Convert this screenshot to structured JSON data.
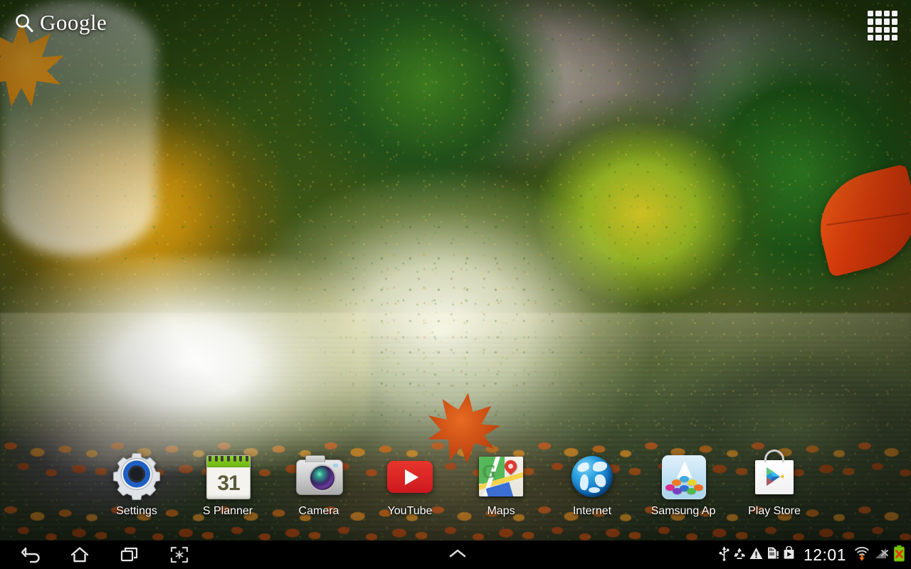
{
  "device": {
    "platform": "Android tablet home screen"
  },
  "search_widget": {
    "icon": "search-icon",
    "brand": "Google",
    "placeholder": "Search"
  },
  "apps_grid_button": {
    "icon": "apps-grid-icon",
    "label": "Apps",
    "cells": 16
  },
  "home_apps": [
    {
      "label": "Settings",
      "icon": "settings-gear-icon"
    },
    {
      "label": "S Planner",
      "icon": "calendar-icon",
      "day": "31"
    },
    {
      "label": "Camera",
      "icon": "camera-icon"
    },
    {
      "label": "YouTube",
      "icon": "youtube-icon"
    },
    {
      "label": "Maps",
      "icon": "maps-icon",
      "glyph": "G"
    },
    {
      "label": "Internet",
      "icon": "globe-icon"
    },
    {
      "label": "Samsung Ap",
      "icon": "samsung-apps-icon"
    },
    {
      "label": "Play Store",
      "icon": "play-store-icon"
    }
  ],
  "navigation_bar": {
    "buttons": [
      {
        "name": "back",
        "icon": "back-arrow-icon"
      },
      {
        "name": "home",
        "icon": "home-icon"
      },
      {
        "name": "recents",
        "icon": "recent-apps-icon"
      },
      {
        "name": "screenshot",
        "icon": "screen-capture-icon"
      }
    ],
    "center": {
      "name": "expand-notifications",
      "icon": "chevron-up-icon"
    }
  },
  "status_bar": {
    "clock": "12:01",
    "icons": [
      {
        "name": "usb-icon",
        "title": "USB connected"
      },
      {
        "name": "sync-recycle-icon",
        "title": "Sync"
      },
      {
        "name": "warning-triangle-icon",
        "title": "Warning"
      },
      {
        "name": "sd-card-alert-icon",
        "title": "SD card"
      },
      {
        "name": "play-store-update-icon",
        "title": "Play Store"
      },
      {
        "name": "wifi-download-icon",
        "title": "Wi-Fi downloading"
      },
      {
        "name": "signal-muted-icon",
        "title": "No signal"
      },
      {
        "name": "battery-error-icon",
        "title": "Battery"
      }
    ]
  },
  "colors": {
    "status_bar_bg": "#000000",
    "label_text": "#ffffff",
    "youtube_red": "#cc181e",
    "calendar_green": "#6fb713",
    "settings_blue": "#1f5fc4",
    "maps_green": "#4a9f4e",
    "maps_pin_red": "#e0382f",
    "battery_green": "#7ac70c",
    "wifi_download_orange": "#e8730e"
  }
}
